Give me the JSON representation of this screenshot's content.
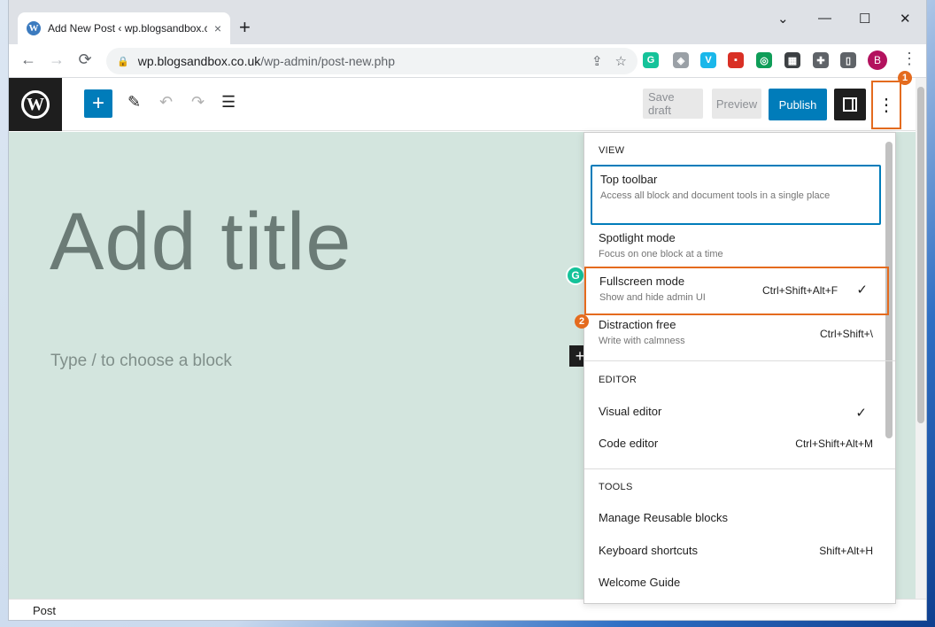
{
  "browser": {
    "tab_title": "Add New Post ‹ wp.blogsandbox.co.uk",
    "tab_favicon": "W",
    "tab_close": "×",
    "new_tab": "+",
    "url_host": "wp.blogsandbox.co.uk",
    "url_path": "/wp-admin/post-new.php",
    "profile_initial": "B",
    "icons": {
      "back": "←",
      "forward": "→",
      "reload": "⟳",
      "lock": "🔒",
      "share": "⇪",
      "star": "☆",
      "menu": "⋮",
      "minimize": "—",
      "maximize": "☐",
      "close": "✕",
      "chevron": "⌄"
    },
    "extensions": [
      {
        "name": "grammarly-extension-icon",
        "glyph": "G",
        "color": "#15c39a"
      },
      {
        "name": "shield-extension-icon",
        "glyph": "◈",
        "color": "#9aa0a6"
      },
      {
        "name": "vimeo-extension-icon",
        "glyph": "V",
        "color": "#1ab7ea"
      },
      {
        "name": "red-extension-icon",
        "glyph": "▪",
        "color": "#d93025"
      },
      {
        "name": "green-extension-icon",
        "glyph": "◎",
        "color": "#0f9d58"
      },
      {
        "name": "dark-extension-icon",
        "glyph": "▦",
        "color": "#3c4043"
      },
      {
        "name": "puzzle-extensions-icon",
        "glyph": "✚",
        "color": "#5f6368"
      },
      {
        "name": "sidepanel-icon",
        "glyph": "▯",
        "color": "#5f6368"
      }
    ]
  },
  "editor": {
    "logo_glyph": "W",
    "add_block": "+",
    "tool_edit": "✎",
    "tool_undo": "↶",
    "tool_redo": "↷",
    "tool_list": "☰",
    "save_draft": "Save draft",
    "preview": "Preview",
    "publish": "Publish",
    "options": "⋮",
    "callout_1": "1",
    "callout_2": "2",
    "title_placeholder": "Add title",
    "block_placeholder": "Type / to choose a block",
    "inserter": "+",
    "grammarly_badge": "G",
    "status": "Post"
  },
  "menu": {
    "view": {
      "title": "View",
      "items": [
        {
          "label": "Top toolbar",
          "desc": "Access all block and document tools in a single place",
          "shortcut": "",
          "checked": false
        },
        {
          "label": "Spotlight mode",
          "desc": "Focus on one block at a time",
          "shortcut": "",
          "checked": false
        },
        {
          "label": "Fullscreen mode",
          "desc": "Show and hide admin UI",
          "shortcut": "Ctrl+Shift+Alt+F",
          "checked": true
        },
        {
          "label": "Distraction free",
          "desc": "Write with calmness",
          "shortcut": "Ctrl+Shift+\\",
          "checked": false
        }
      ]
    },
    "editor": {
      "title": "Editor",
      "items": [
        {
          "label": "Visual editor",
          "shortcut": "",
          "checked": true
        },
        {
          "label": "Code editor",
          "shortcut": "Ctrl+Shift+Alt+M",
          "checked": false
        }
      ]
    },
    "tools": {
      "title": "Tools",
      "items": [
        {
          "label": "Manage Reusable blocks",
          "shortcut": ""
        },
        {
          "label": "Keyboard shortcuts",
          "shortcut": "Shift+Alt+H"
        },
        {
          "label": "Welcome Guide",
          "shortcut": ""
        }
      ]
    },
    "check_glyph": "✓"
  }
}
